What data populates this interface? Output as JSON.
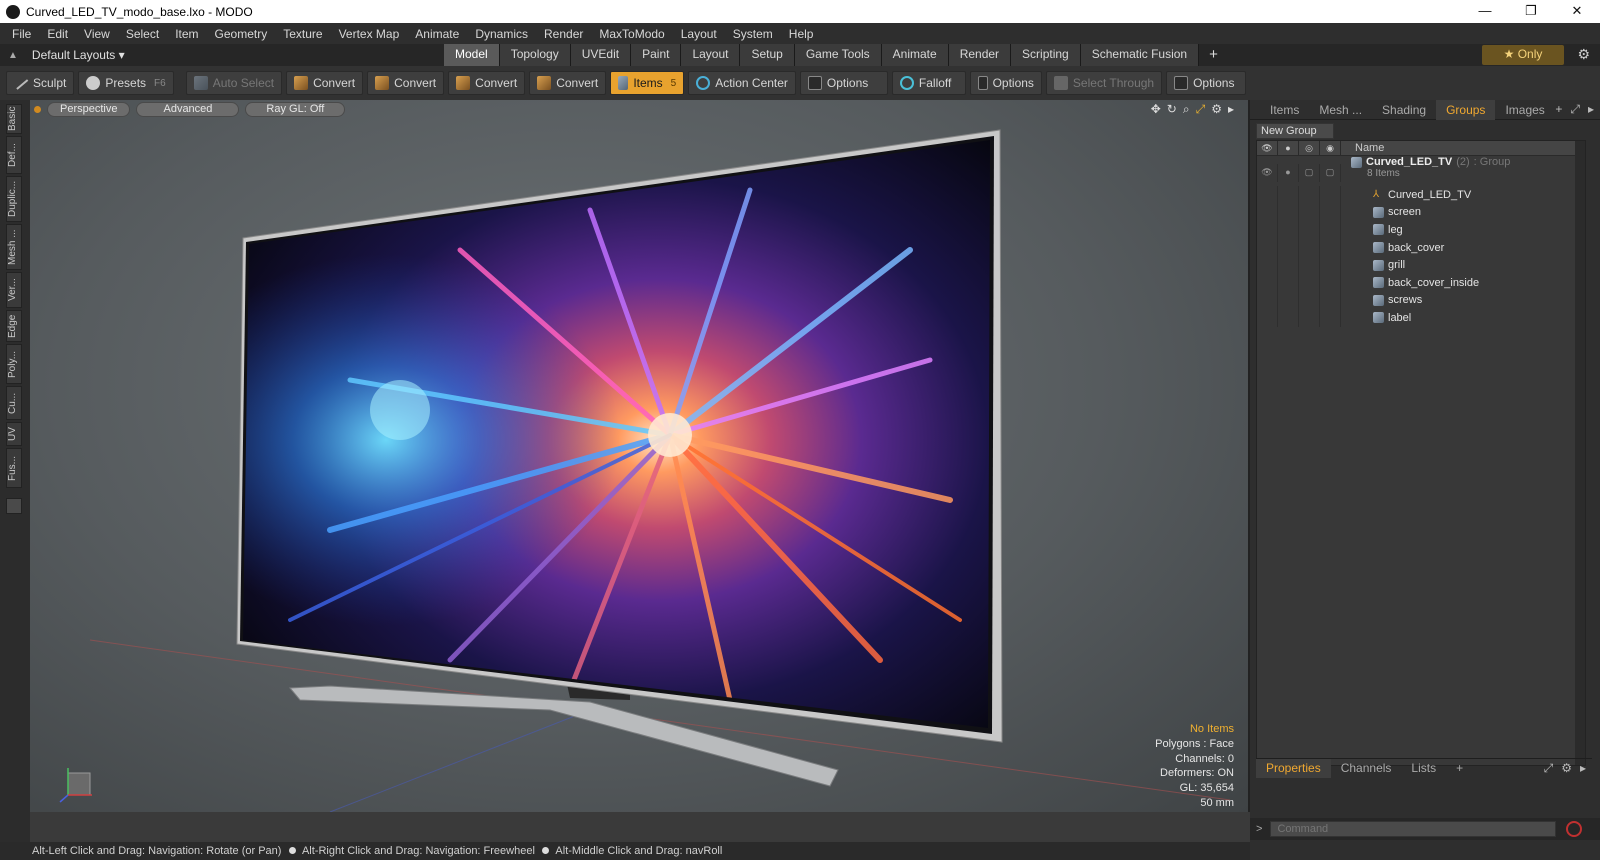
{
  "window": {
    "title": "Curved_LED_TV_modo_base.lxo - MODO",
    "controls": [
      "—",
      "❐",
      "✕"
    ]
  },
  "menu": [
    "File",
    "Edit",
    "View",
    "Select",
    "Item",
    "Geometry",
    "Texture",
    "Vertex Map",
    "Animate",
    "Dynamics",
    "Render",
    "MaxToModo",
    "Layout",
    "System",
    "Help"
  ],
  "layout_bar": {
    "layouts_label": "Default Layouts ▾",
    "tabs": [
      "Model",
      "Topology",
      "UVEdit",
      "Paint",
      "Layout",
      "Setup",
      "Game Tools",
      "Animate",
      "Render",
      "Scripting",
      "Schematic Fusion"
    ],
    "active_tab": "Model",
    "plus": "+",
    "only_label": "★  Only"
  },
  "toolbar": {
    "sculpt": "Sculpt",
    "presets": "Presets",
    "presets_key": "F6",
    "auto_select": "Auto Select",
    "convert": "Convert",
    "items": "Items",
    "items_key": "5",
    "action_center": "Action Center",
    "options": "Options",
    "falloff": "Falloff",
    "select_through": "Select Through"
  },
  "left_tabs": [
    "Basic",
    "Def...",
    "Duplic...",
    "Mesh ...",
    "Ver...",
    "Edge",
    "Poly...",
    "Cu...",
    "UV",
    "Fus..."
  ],
  "viewport": {
    "view_mode": "Perspective",
    "shading": "Advanced",
    "raygl": "Ray GL: Off",
    "info": {
      "selection": "No Items",
      "polygons": "Polygons : Face",
      "channels": "Channels: 0",
      "deformers": "Deformers: ON",
      "gl": "GL: 35,654",
      "scale": "50 mm"
    }
  },
  "status_bar": {
    "hint1": "Alt-Left Click and Drag: Navigation: Rotate (or Pan)",
    "hint2": "Alt-Right Click and Drag: Navigation: Freewheel",
    "hint3": "Alt-Middle Click and Drag: navRoll"
  },
  "right_panel": {
    "tabs": [
      "Items",
      "Mesh ...",
      "Shading",
      "Groups",
      "Images"
    ],
    "active_tab": "Groups",
    "new_group": "New Group",
    "name_header": "Name",
    "group": {
      "name": "Curved_LED_TV",
      "count": "(2)",
      "type": ": Group",
      "subtitle": "8 Items"
    },
    "items": [
      {
        "name": "Curved_LED_TV",
        "kind": "locator"
      },
      {
        "name": "screen",
        "kind": "mesh"
      },
      {
        "name": "leg",
        "kind": "mesh"
      },
      {
        "name": "back_cover",
        "kind": "mesh"
      },
      {
        "name": "grill",
        "kind": "mesh"
      },
      {
        "name": "back_cover_inside",
        "kind": "mesh"
      },
      {
        "name": "screws",
        "kind": "mesh"
      },
      {
        "name": "label",
        "kind": "mesh"
      }
    ],
    "bottom_tabs": [
      "Properties",
      "Channels",
      "Lists"
    ],
    "bottom_active": "Properties",
    "command_placeholder": "Command"
  },
  "colors": {
    "accent": "#f0a830",
    "items_button": "#e8a22e",
    "viewport_bg": "#5d6265"
  }
}
